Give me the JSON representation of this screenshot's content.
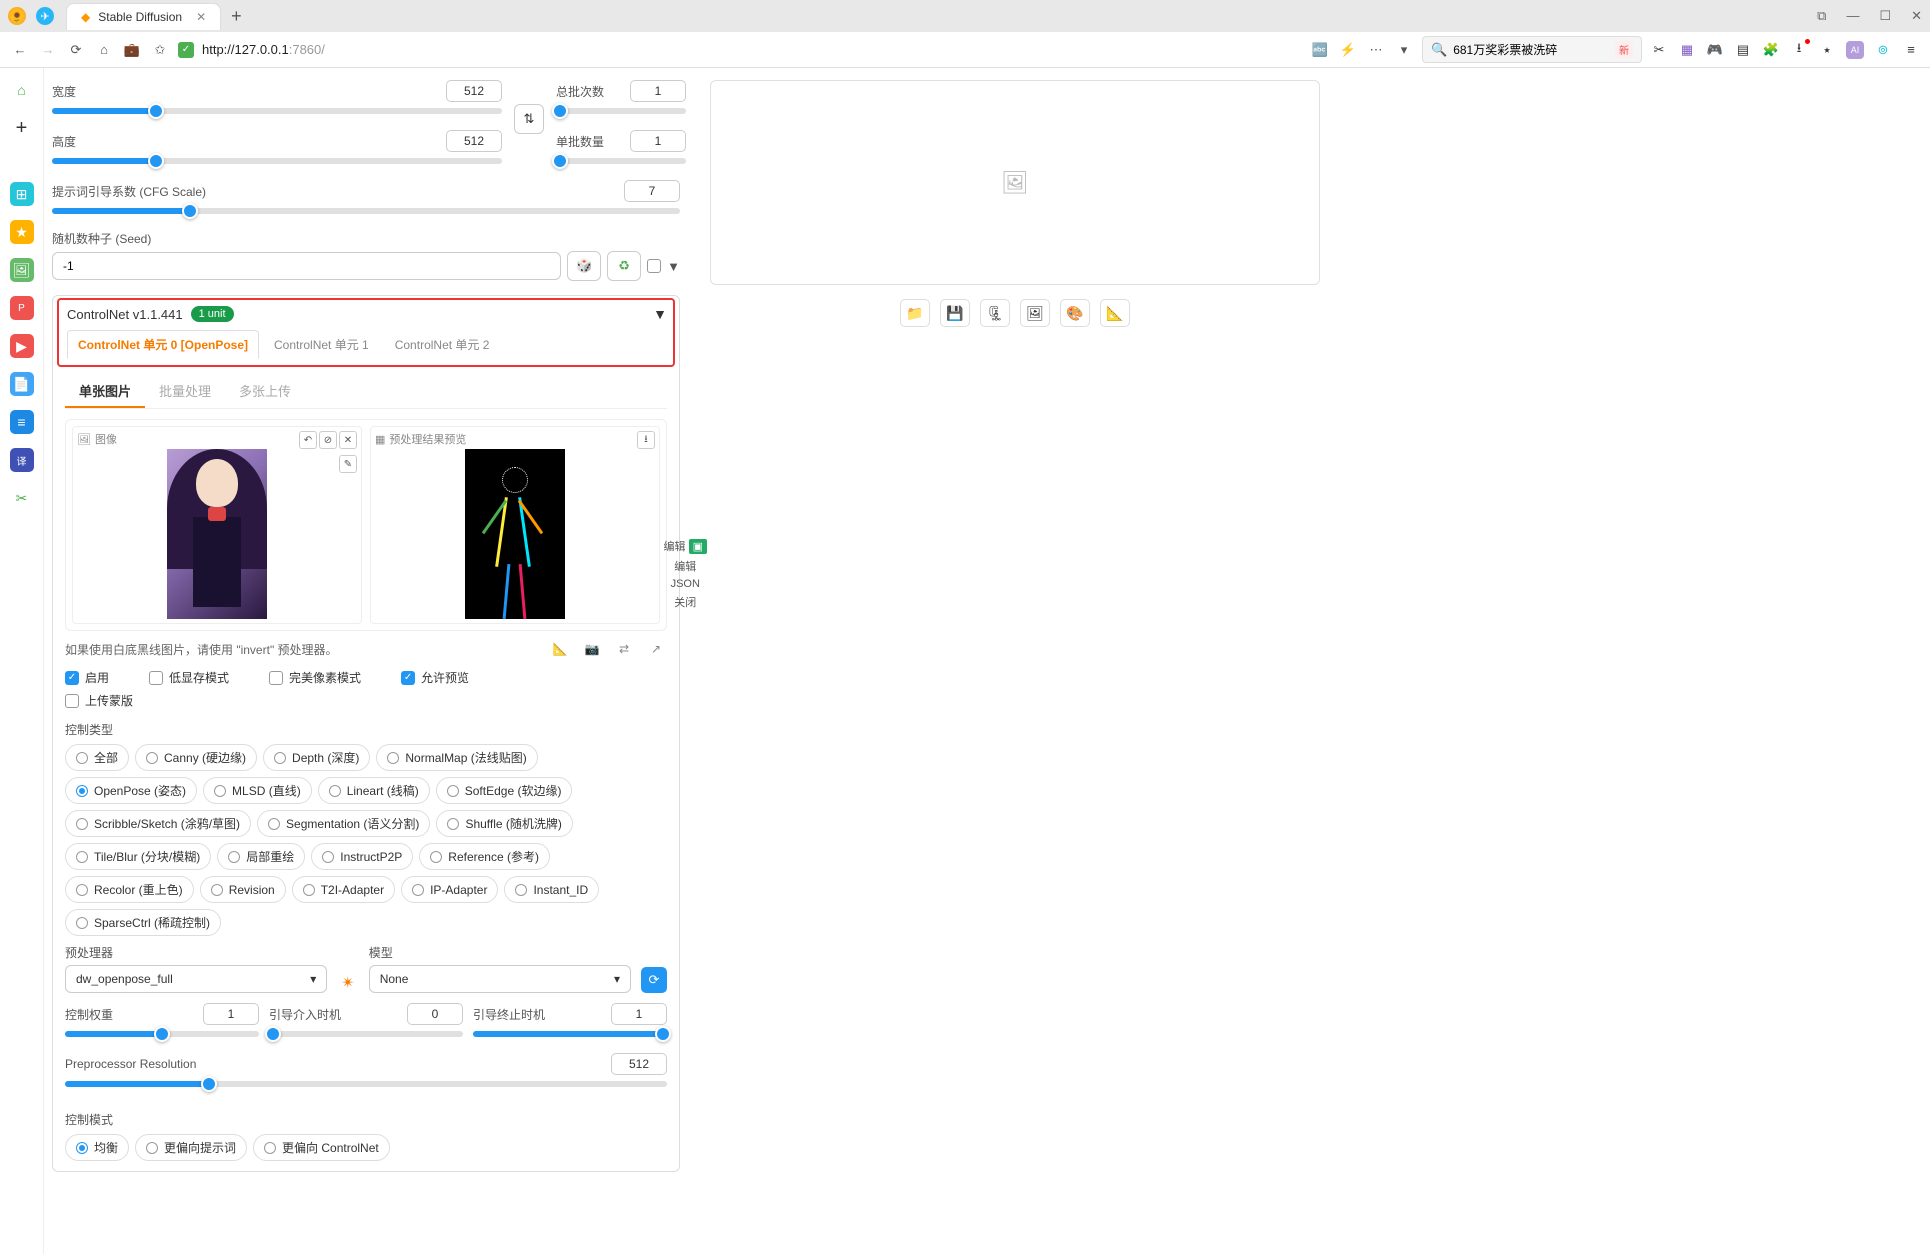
{
  "window": {
    "tab_title": "Stable Diffusion"
  },
  "toolbar": {
    "url_host": "http://127.0.0.1",
    "url_port": ":7860/",
    "search_value": "681万奖彩票被洗碎",
    "badge_new": "新"
  },
  "sliders": {
    "width": {
      "label": "宽度",
      "value": "512"
    },
    "height": {
      "label": "高度",
      "value": "512"
    },
    "batch_count": {
      "label": "总批次数",
      "value": "1"
    },
    "batch_size": {
      "label": "单批数量",
      "value": "1"
    },
    "cfg": {
      "label": "提示词引导系数 (CFG Scale)",
      "value": "7"
    },
    "seed": {
      "label": "随机数种子 (Seed)",
      "value": "-1"
    }
  },
  "controlnet": {
    "title": "ControlNet v1.1.441",
    "badge": "1 unit",
    "tabs": [
      "ControlNet 单元 0 [OpenPose]",
      "ControlNet 单元 1",
      "ControlNet 单元 2"
    ],
    "subtabs": [
      "单张图片",
      "批量处理",
      "多张上传"
    ],
    "image_label": "图像",
    "preview_label": "预处理结果预览",
    "edit_side": {
      "edit_box": "编辑",
      "edit": "编辑",
      "json": "JSON",
      "close": "关闭"
    },
    "hint": "如果使用白底黑线图片，请使用 \"invert\" 预处理器。",
    "checks": {
      "enable": "启用",
      "lowvram": "低显存模式",
      "pixel_perfect": "完美像素模式",
      "allow_preview": "允许预览",
      "mask_upload": "上传蒙版"
    },
    "control_type_label": "控制类型",
    "control_types": [
      "全部",
      "Canny (硬边缘)",
      "Depth (深度)",
      "NormalMap (法线贴图)",
      "OpenPose (姿态)",
      "MLSD (直线)",
      "Lineart (线稿)",
      "SoftEdge (软边缘)",
      "Scribble/Sketch (涂鸦/草图)",
      "Segmentation (语义分割)",
      "Shuffle (随机洗牌)",
      "Tile/Blur (分块/模糊)",
      "局部重绘",
      "InstructP2P",
      "Reference (参考)",
      "Recolor (重上色)",
      "Revision",
      "T2I-Adapter",
      "IP-Adapter",
      "Instant_ID",
      "SparseCtrl (稀疏控制)"
    ],
    "control_type_selected": 4,
    "preproc_label": "预处理器",
    "preproc_value": "dw_openpose_full",
    "model_label": "模型",
    "model_value": "None",
    "weight": {
      "label": "控制权重",
      "value": "1"
    },
    "guide_start": {
      "label": "引导介入时机",
      "value": "0"
    },
    "guide_end": {
      "label": "引导终止时机",
      "value": "1"
    },
    "preproc_res": {
      "label": "Preprocessor Resolution",
      "value": "512"
    },
    "control_mode_label": "控制模式",
    "control_modes": [
      "均衡",
      "更偏向提示词",
      "更偏向 ControlNet"
    ],
    "control_mode_selected": 0
  }
}
